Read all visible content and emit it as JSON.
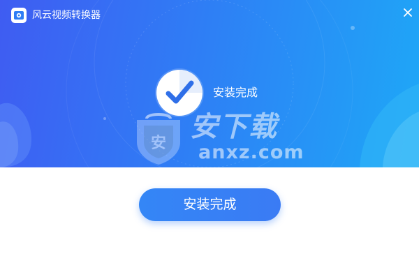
{
  "window": {
    "title": "风云视频转换器",
    "icons": {
      "app": "app-logo-icon",
      "close": "close-icon",
      "status": "check-circle-icon",
      "watermark": "shield-icon"
    }
  },
  "status": {
    "text": "安装完成"
  },
  "watermark": {
    "brand_cn": "安下载",
    "brand_en": "anxz.com",
    "shield_char": "安"
  },
  "actions": {
    "primary_label": "安装完成"
  },
  "colors": {
    "hero_start": "#3f5cf2",
    "hero_mid": "#2f7df5",
    "hero_end": "#1ea8f7",
    "button": "#3486f6",
    "check": "#2f6fe8"
  }
}
